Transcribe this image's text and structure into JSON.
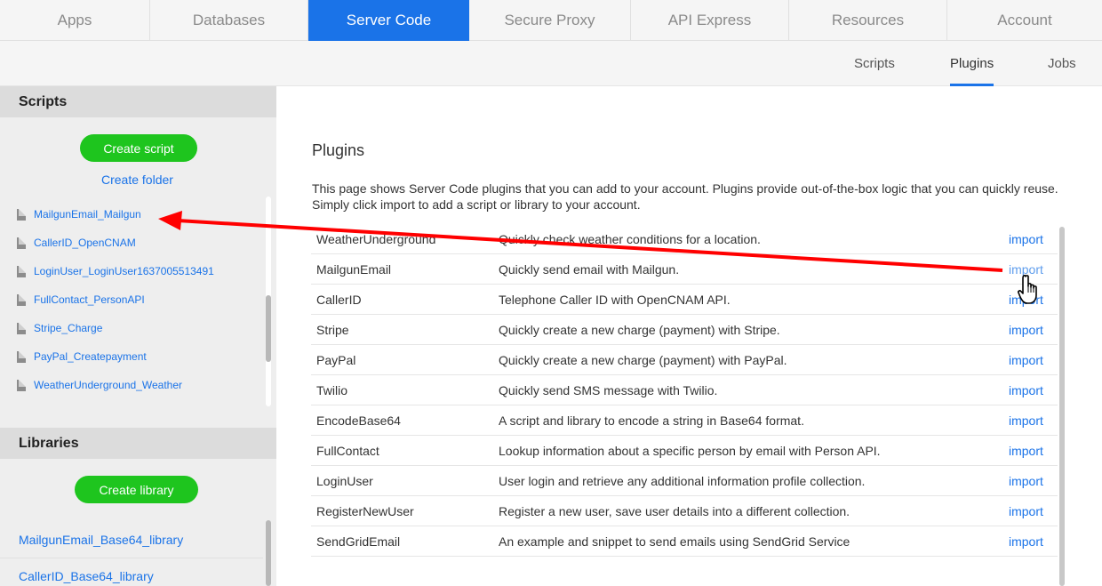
{
  "topnav": {
    "tabs": [
      {
        "label": "Apps",
        "active": false
      },
      {
        "label": "Databases",
        "active": false
      },
      {
        "label": "Server Code",
        "active": true
      },
      {
        "label": "Secure Proxy",
        "active": false
      },
      {
        "label": "API Express",
        "active": false
      },
      {
        "label": "Resources",
        "active": false
      },
      {
        "label": "Account",
        "active": false
      }
    ]
  },
  "subnav": {
    "items": [
      {
        "label": "Scripts",
        "active": false
      },
      {
        "label": "Plugins",
        "active": true
      },
      {
        "label": "Jobs",
        "active": false
      }
    ]
  },
  "sidebar": {
    "scripts_header": "Scripts",
    "create_script": "Create script",
    "create_folder": "Create folder",
    "scripts": [
      "MailgunEmail_Mailgun",
      "CallerID_OpenCNAM",
      "LoginUser_LoginUser1637005513491",
      "FullContact_PersonAPI",
      "Stripe_Charge",
      "PayPal_Createpayment",
      "WeatherUnderground_Weather"
    ],
    "libraries_header": "Libraries",
    "create_library": "Create library",
    "libraries": [
      "MailgunEmail_Base64_library",
      "CallerID_Base64_library"
    ]
  },
  "main": {
    "title": "Plugins",
    "description": "This page shows Server Code plugins that you can add to your account. Plugins provide out-of-the-box logic that you can quickly reuse. Simply click import to add a script or library to your account.",
    "plugins": [
      {
        "name": "WeatherUnderground",
        "description": "Quickly check weather conditions for a location.",
        "action": "import"
      },
      {
        "name": "MailgunEmail",
        "description": "Quickly send email with Mailgun.",
        "action": "import"
      },
      {
        "name": "CallerID",
        "description": "Telephone Caller ID with OpenCNAM API.",
        "action": "import"
      },
      {
        "name": "Stripe",
        "description": "Quickly create a new charge (payment) with Stripe.",
        "action": "import"
      },
      {
        "name": "PayPal",
        "description": "Quickly create a new charge (payment) with PayPal.",
        "action": "import"
      },
      {
        "name": "Twilio",
        "description": "Quickly send SMS message with Twilio.",
        "action": "import"
      },
      {
        "name": "EncodeBase64",
        "description": "A script and library to encode a string in Base64 format.",
        "action": "import"
      },
      {
        "name": "FullContact",
        "description": "Lookup information about a specific person by email with Person API.",
        "action": "import"
      },
      {
        "name": "LoginUser",
        "description": "User login and retrieve any additional information profile collection.",
        "action": "import"
      },
      {
        "name": "RegisterNewUser",
        "description": "Register a new user, save user details into a different collection.",
        "action": "import"
      },
      {
        "name": "SendGridEmail",
        "description": "An example and snippet to send emails using SendGrid Service",
        "action": "import"
      }
    ]
  },
  "colors": {
    "accent": "#1a73e8",
    "green_button": "#1ec51e",
    "annotation_arrow": "#ff0000"
  },
  "icons": {
    "script_item": "file-icon",
    "cursor": "hand-pointer-icon"
  }
}
